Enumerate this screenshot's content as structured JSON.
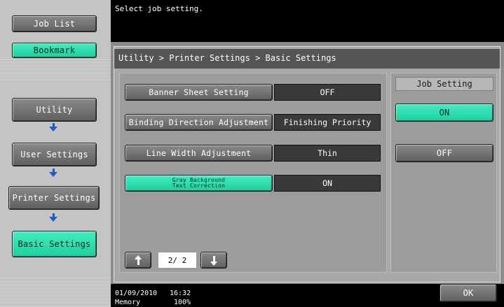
{
  "sidebar": {
    "job_list": "Job List",
    "bookmark": "Bookmark",
    "utility": "Utility",
    "user_settings": "User Settings",
    "printer_settings": "Printer Settings",
    "basic_settings": "Basic Settings"
  },
  "top": {
    "message": "Select job setting."
  },
  "breadcrumb": "Utility > Printer Settings > Basic Settings",
  "settings": [
    {
      "label": "Banner Sheet Setting",
      "value": "OFF"
    },
    {
      "label": "Binding Direction Adjustment",
      "value": "Finishing Priority"
    },
    {
      "label": "Line Width Adjustment",
      "value": "Thin"
    },
    {
      "label_line1": "Gray Background",
      "label_line2": "Text Correction",
      "value": "ON"
    }
  ],
  "pager": {
    "text": "2/ 2"
  },
  "job_setting": {
    "title": "Job Setting",
    "on": "ON",
    "off": "OFF"
  },
  "status": {
    "date": "01/09/2010",
    "time": "16:32",
    "memory_label": "Memory",
    "memory_value": "100%"
  },
  "ok": "OK",
  "colors": {
    "accent_green": "#22d9a8",
    "arrow_blue": "#1a5ad8",
    "panel_gray": "#9c9c9c"
  }
}
